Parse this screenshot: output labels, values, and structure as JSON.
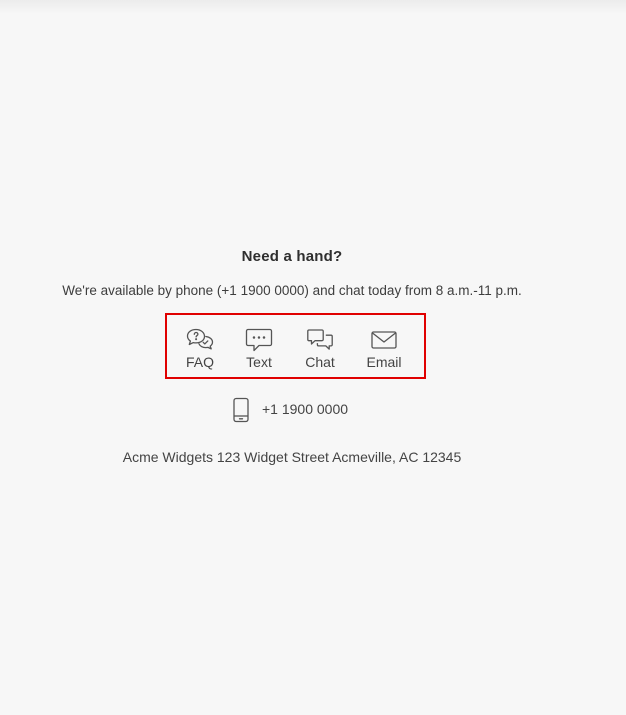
{
  "help": {
    "title": "Need a hand?",
    "availability": "We're available by phone (+1 1900 0000) and chat today from 8 a.m.-11 p.m.",
    "channels": [
      {
        "label": "FAQ",
        "icon": "faq-icon"
      },
      {
        "label": "Text",
        "icon": "text-message-icon"
      },
      {
        "label": "Chat",
        "icon": "chat-bubbles-icon"
      },
      {
        "label": "Email",
        "icon": "envelope-icon"
      }
    ],
    "phone": {
      "icon": "mobile-phone-icon",
      "number": "+1 1900 0000"
    },
    "address": "Acme Widgets 123 Widget Street Acmeville, AC 12345"
  },
  "colors": {
    "background": "#f7f7f7",
    "highlight_border": "#e00000",
    "text": "#444444"
  }
}
